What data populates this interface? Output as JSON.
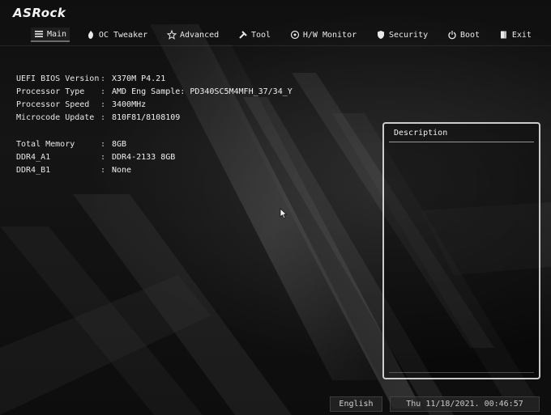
{
  "brand": {
    "logo_text": "ASRock"
  },
  "menu": {
    "items": [
      {
        "label": "Main",
        "icon": "list-icon",
        "active": true
      },
      {
        "label": "OC Tweaker",
        "icon": "flame-icon"
      },
      {
        "label": "Advanced",
        "icon": "star-icon"
      },
      {
        "label": "Tool",
        "icon": "wrench-icon"
      },
      {
        "label": "H/W Monitor",
        "icon": "monitor-icon"
      },
      {
        "label": "Security",
        "icon": "shield-icon"
      },
      {
        "label": "Boot",
        "icon": "power-icon"
      },
      {
        "label": "Exit",
        "icon": "exit-icon"
      }
    ]
  },
  "system_info": {
    "uefi_version": {
      "label": "UEFI BIOS Version",
      "value": "X370M P4.21"
    },
    "processor_type": {
      "label": "Processor Type",
      "value": "AMD Eng Sample: PD340SC5M4MFH_37/34_Y"
    },
    "processor_speed": {
      "label": "Processor Speed",
      "value": "3400MHz"
    },
    "microcode_update": {
      "label": "Microcode Update",
      "value": "810F81/8108109"
    },
    "total_memory": {
      "label": "Total Memory",
      "value": "8GB"
    },
    "ddr4_a1": {
      "label": "DDR4_A1",
      "value": "DDR4-2133 8GB"
    },
    "ddr4_b1": {
      "label": "DDR4_B1",
      "value": "None"
    }
  },
  "description_panel": {
    "title": "Description"
  },
  "status_bar": {
    "language": "English",
    "datetime": "Thu 11/18/2021. 00:46:57"
  },
  "colors": {
    "text": "#e6e6e6",
    "background": "#0f0f0f",
    "panel_border": "#cfcfcf"
  }
}
